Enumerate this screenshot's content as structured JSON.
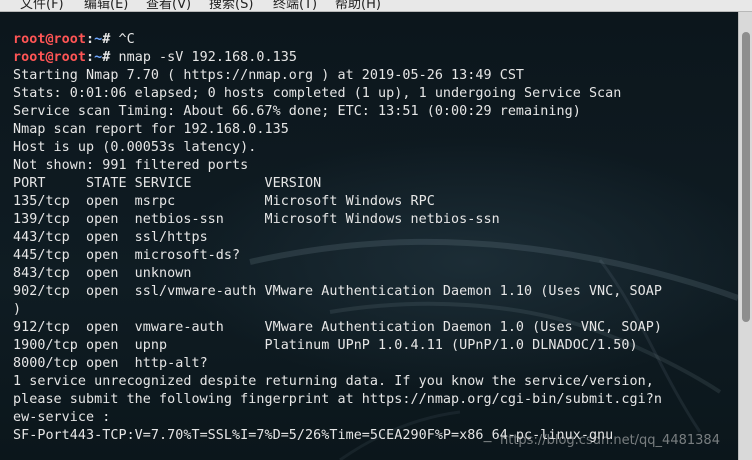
{
  "menu": {
    "items": [
      "文件(F)",
      "编辑(E)",
      "查看(V)",
      "搜索(S)",
      "终端(T)",
      "帮助(H)"
    ]
  },
  "terminal": {
    "prompt_user": "root@root",
    "prompt_path": "~",
    "lines": [
      {
        "prompt": true,
        "cmd": " ^C"
      },
      {
        "prompt": true,
        "cmd": " nmap -sV 192.168.0.135"
      },
      {
        "text": "Starting Nmap 7.70 ( https://nmap.org ) at 2019-05-26 13:49 CST"
      },
      {
        "text": "Stats: 0:01:06 elapsed; 0 hosts completed (1 up), 1 undergoing Service Scan"
      },
      {
        "text": "Service scan Timing: About 66.67% done; ETC: 13:51 (0:00:29 remaining)"
      },
      {
        "text": "Nmap scan report for 192.168.0.135"
      },
      {
        "text": "Host is up (0.00053s latency)."
      },
      {
        "text": "Not shown: 991 filtered ports"
      },
      {
        "text": "PORT     STATE SERVICE         VERSION"
      },
      {
        "text": "135/tcp  open  msrpc           Microsoft Windows RPC"
      },
      {
        "text": "139/tcp  open  netbios-ssn     Microsoft Windows netbios-ssn"
      },
      {
        "text": "443/tcp  open  ssl/https"
      },
      {
        "text": "445/tcp  open  microsoft-ds?"
      },
      {
        "text": "843/tcp  open  unknown"
      },
      {
        "text": "902/tcp  open  ssl/vmware-auth VMware Authentication Daemon 1.10 (Uses VNC, SOAP"
      },
      {
        "text": ")"
      },
      {
        "text": "912/tcp  open  vmware-auth     VMware Authentication Daemon 1.0 (Uses VNC, SOAP)"
      },
      {
        "text": "1900/tcp open  upnp            Platinum UPnP 1.0.4.11 (UPnP/1.0 DLNADOC/1.50)"
      },
      {
        "text": "8000/tcp open  http-alt?"
      },
      {
        "text": "1 service unrecognized despite returning data. If you know the service/version,"
      },
      {
        "text": "please submit the following fingerprint at https://nmap.org/cgi-bin/submit.cgi?n"
      },
      {
        "text": "ew-service :"
      },
      {
        "text": "SF-Port443-TCP:V=7.70%T=SSL%I=7%D=5/26%Time=5CEA290F%P=x86_64-pc-linux-gnu"
      }
    ]
  },
  "watermark": "https://blog.csdn.net/qq_4481384",
  "colors": {
    "background": "#0b1419",
    "text": "#e6e6e6",
    "prompt_user": "#ff5555",
    "prompt_path": "#6fa8ff"
  }
}
